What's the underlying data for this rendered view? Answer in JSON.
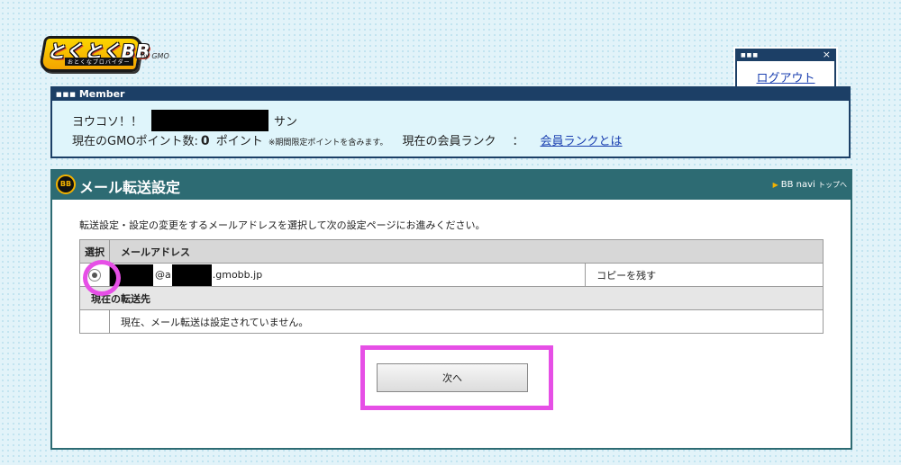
{
  "logo": {
    "main": "とくとくBB",
    "sub": "おとくなプロバイダー",
    "gmo": "by GMO"
  },
  "logout": {
    "dots": "■■■",
    "close": "×",
    "label": "ログアウト"
  },
  "member": {
    "header": "Member",
    "header_icon": "■■■",
    "welcome_prefix": "ヨウコソ！！",
    "welcome_suffix": "サン",
    "points_label": "現在のGMOポイント数:",
    "points_value": "0",
    "points_unit": "ポイント",
    "points_note": "※期間限定ポイントを含みます。",
    "rank_label": "現在の会員ランク",
    "rank_colon": "：",
    "rank_link": "会員ランクとは"
  },
  "main": {
    "icon_text": "BB",
    "title": "メール転送設定",
    "navi_arrow": "▶",
    "navi_label": "BB navi",
    "navi_suffix": "トップへ",
    "instruction": "転送設定・設定の変更をするメールアドレスを選択して次の設定ページにお進みください。",
    "table": {
      "col_select": "選択",
      "col_address": "メールアドレス",
      "email_at": "@a",
      "email_domain": ".gmobb.jp",
      "copy_option": "コピーを残す",
      "forward_header": "現在の転送先",
      "forward_status": "現在、メール転送は設定されていません。"
    },
    "next_button": "次へ"
  },
  "colors": {
    "navy": "#1c3f66",
    "teal": "#2d6b73",
    "highlight": "#e64fe6",
    "link": "#1a3fb0"
  }
}
